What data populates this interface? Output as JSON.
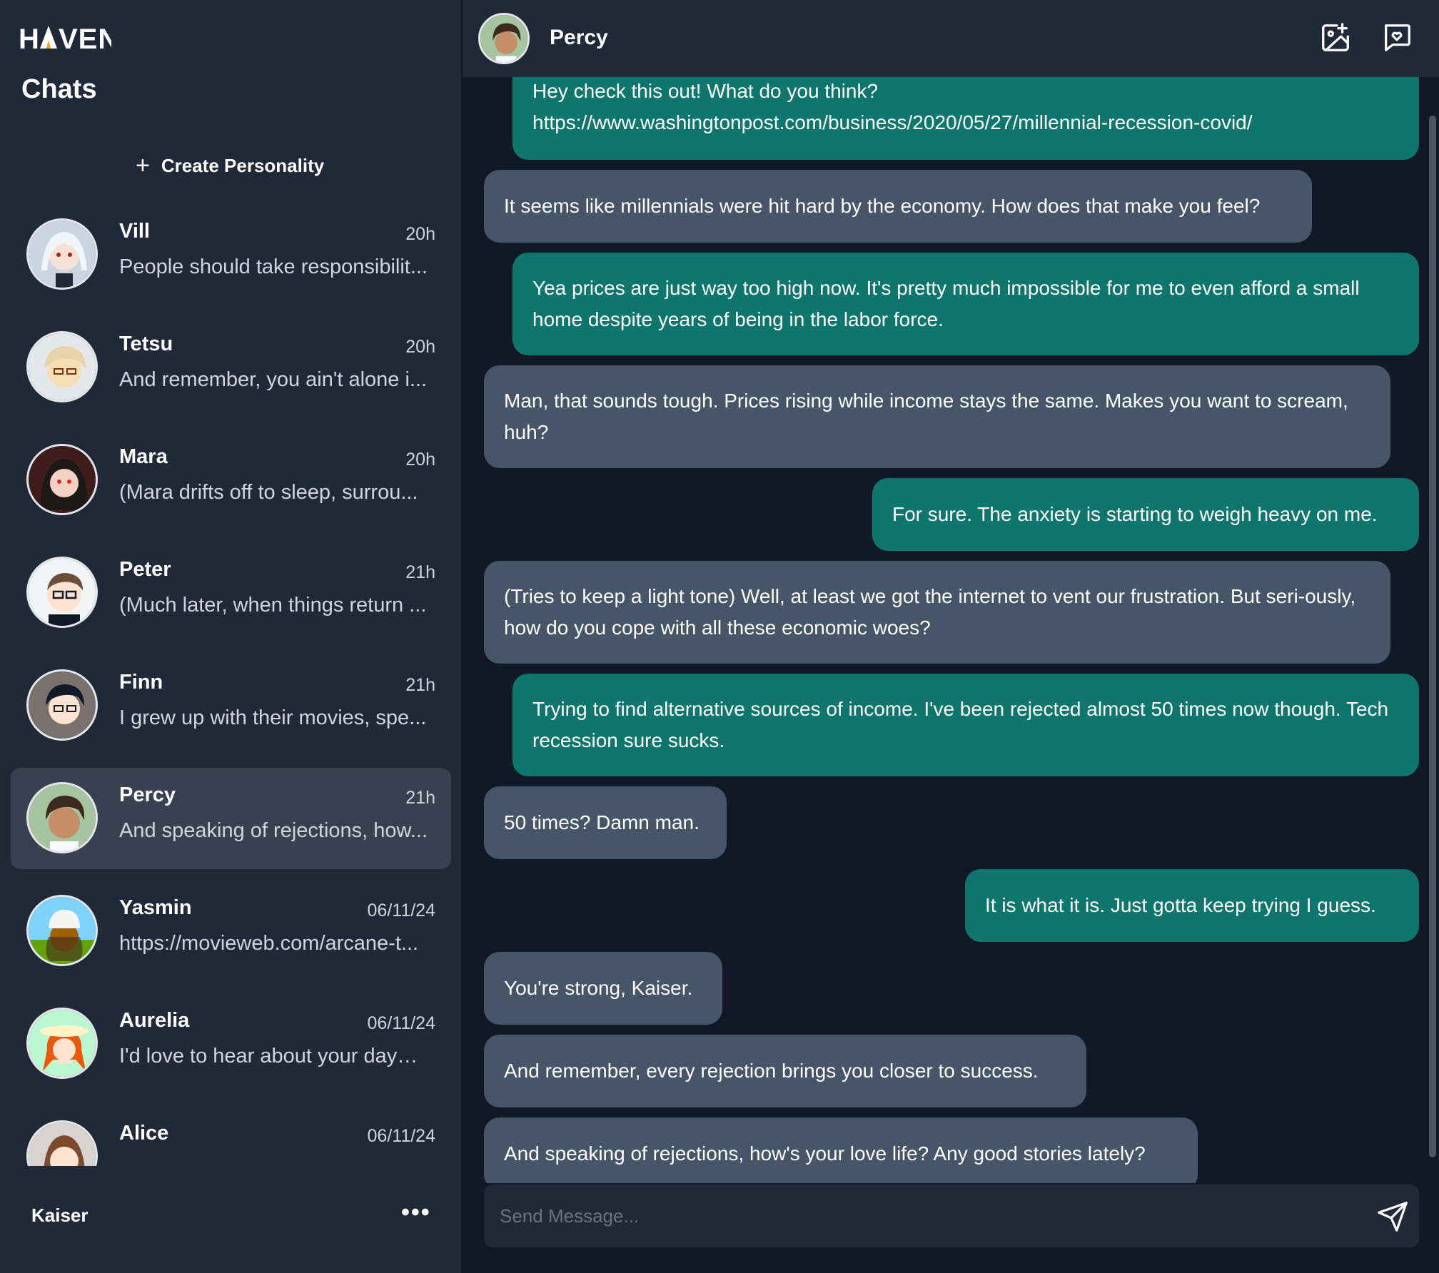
{
  "app": {
    "logo": "HAVEN",
    "section_title": "Chats",
    "create_label": "Create Personality"
  },
  "chats": [
    {
      "name": "Vill",
      "time": "20h",
      "preview": "People should take responsibilit...",
      "avatar": "anime-avatar-white-hair"
    },
    {
      "name": "Tetsu",
      "time": "20h",
      "preview": "And remember, you ain't alone i...",
      "avatar": "anime-avatar-blond-glasses"
    },
    {
      "name": "Mara",
      "time": "20h",
      "preview": "(Mara drifts off to sleep, surrou...",
      "avatar": "anime-avatar-dark-hair"
    },
    {
      "name": "Peter",
      "time": "21h",
      "preview": "(Much later, when things return ...",
      "avatar": "anime-avatar-glasses"
    },
    {
      "name": "Finn",
      "time": "21h",
      "preview": "I grew up with their movies, spe...",
      "avatar": "anime-avatar-black-hair-glasses"
    },
    {
      "name": "Percy",
      "time": "21h",
      "preview": "And speaking of rejections, how...",
      "avatar": "anime-avatar-brown-hair"
    },
    {
      "name": "Yasmin",
      "time": "06/11/24",
      "preview": "https://movieweb.com/arcane-t...",
      "avatar": "anime-avatar-beanie"
    },
    {
      "name": "Aurelia",
      "time": "06/11/24",
      "preview": "I'd love to hear about your day—...",
      "avatar": "anime-avatar-red-hair-hat"
    },
    {
      "name": "Alice",
      "time": "06/11/24",
      "preview": "",
      "avatar": "anime-avatar-brown-long-hair"
    }
  ],
  "user": {
    "name": "Kaiser",
    "more_label": "•••"
  },
  "conversation": {
    "name": "Percy",
    "messages": [
      {
        "role": "user",
        "text": "Hey check this out! What do you think? https://www.washingtonpost.com/business/2020/05/27/millennial-recession-covid/"
      },
      {
        "role": "bot",
        "text": "It seems like millennials were hit hard by the economy. How does that make you feel?"
      },
      {
        "role": "user",
        "text": "Yea prices are just way too high now. It's pretty much impossible for me to even afford a small home despite years of being in the labor force."
      },
      {
        "role": "bot",
        "text": "Man, that sounds tough. Prices rising while income stays the same. Makes you want to scream, huh?"
      },
      {
        "role": "user",
        "text": "For sure. The anxiety is starting to weigh heavy on me."
      },
      {
        "role": "bot",
        "text": "(Tries to keep a light tone) Well, at least we got the internet to vent our frustration. But seri-ously, how do you cope with all these economic woes?"
      },
      {
        "role": "user",
        "text": "Trying to find alternative sources of income. I've been rejected almost 50 times now though. Tech recession sure sucks."
      },
      {
        "role": "bot",
        "text": "50 times? Damn man."
      },
      {
        "role": "user",
        "text": "It is what it is. Just gotta keep trying I guess."
      },
      {
        "role": "bot",
        "text": "You're strong, Kaiser."
      },
      {
        "role": "bot",
        "text": "And remember, every rejection brings you closer to success."
      },
      {
        "role": "bot",
        "text": "And speaking of rejections, how's your love life? Any good stories lately?"
      }
    ]
  },
  "composer": {
    "placeholder": "Send Message...",
    "value": ""
  },
  "colors": {
    "user_bubble": "#0f766e",
    "bot_bubble": "#475569",
    "sidebar": "#1f2937",
    "background": "#111827",
    "active_item": "#374151"
  }
}
